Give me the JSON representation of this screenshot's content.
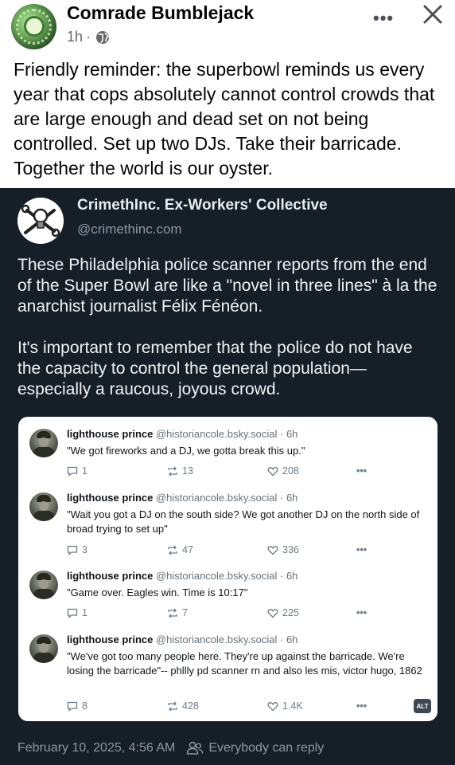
{
  "post": {
    "author": "Comrade Bumblejack",
    "time": "1h",
    "separator": "·",
    "text": "Friendly reminder: the superbowl reminds us every year that cops absolutely cannot control crowds that are large enough and dead set on not being controlled. Set up two DJs. Take their barricade. Together the world is our oyster.",
    "more_label": "•••"
  },
  "embed": {
    "author": "CrimethInc. Ex-Workers' Collective",
    "handle": "@crimethinc.com",
    "paragraphs": [
      "These Philadelphia police scanner reports from the end of the Super Bowl are like a \"novel in three lines\" à la the anarchist journalist Félix Fénéon.",
      "It's important to remember that the police do not have the capacity to control the general population—especially a raucous, joyous crowd."
    ],
    "date": "February 10, 2025, 4:56 AM",
    "reply_setting": "Everybody can reply"
  },
  "quoted": {
    "alt_label": "ALT",
    "posts": [
      {
        "name": "lighthouse prince",
        "handle": "@historiancole.bsky.social",
        "time": "· 6h",
        "text": "\"We got fireworks and a DJ, we gotta break this up.\"",
        "replies": "1",
        "reposts": "13",
        "likes": "208",
        "more": "•••"
      },
      {
        "name": "lighthouse prince",
        "handle": "@historiancole.bsky.social",
        "time": "· 6h",
        "text": "\"Wait you got a DJ on the south side? We got another DJ on the north side of broad trying to set up\"",
        "replies": "3",
        "reposts": "47",
        "likes": "336",
        "more": "•••"
      },
      {
        "name": "lighthouse prince",
        "handle": "@historiancole.bsky.social",
        "time": "· 6h",
        "text": "\"Game over. Eagles win. Time is 10:17\"",
        "replies": "1",
        "reposts": "7",
        "likes": "225",
        "more": "•••"
      },
      {
        "name": "lighthouse prince",
        "handle": "@historiancole.bsky.social",
        "time": "· 6h",
        "text": "\"We've got too many people here. They're up against the barricade. We're losing the barricade\"-- phllly pd scanner rn and also les mis, victor hugo, 1862",
        "replies": "8",
        "reposts": "428",
        "likes": "1.4K",
        "more": "•••"
      }
    ]
  },
  "icons": {
    "globe": "globe-icon",
    "close": "close-icon",
    "people": "people-icon",
    "reply": "reply-icon",
    "repost": "repost-icon",
    "like": "heart-icon"
  },
  "colors": {
    "embed_bg": "#161e27",
    "action_gray": "#6e7b88",
    "meta_gray": "#65676b"
  }
}
